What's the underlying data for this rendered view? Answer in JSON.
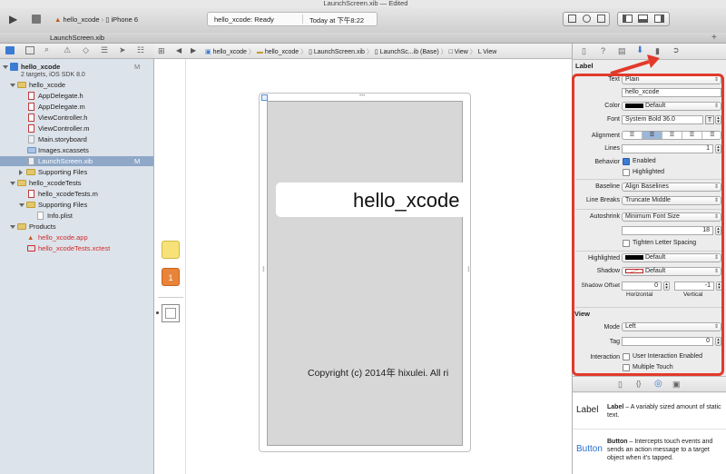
{
  "window": {
    "title": "LaunchScreen.xib — Edited"
  },
  "toolbar": {
    "scheme": "hello_xcode",
    "device": "iPhone 6",
    "status": "hello_xcode: Ready",
    "status_time": "Today at 下午8:22"
  },
  "tab": {
    "label": "LaunchScreen.xib"
  },
  "jumpbar": {
    "items": [
      "hello_xcode",
      "hello_xcode",
      "LaunchScreen.xib",
      "LaunchSc...ib (Base)",
      "View",
      "View"
    ]
  },
  "navigator": {
    "project": {
      "name": "hello_xcode",
      "subtitle": "2 targets, iOS SDK 8.0",
      "badge": "M"
    },
    "items": [
      {
        "label": "hello_xcode",
        "kind": "folder"
      },
      {
        "label": "AppDelegate.h",
        "kind": "h"
      },
      {
        "label": "AppDelegate.m",
        "kind": "m"
      },
      {
        "label": "ViewController.h",
        "kind": "h"
      },
      {
        "label": "ViewController.m",
        "kind": "m"
      },
      {
        "label": "Main.storyboard",
        "kind": "storyboard"
      },
      {
        "label": "Images.xcassets",
        "kind": "assets"
      },
      {
        "label": "LaunchScreen.xib",
        "kind": "xib",
        "badge": "M"
      },
      {
        "label": "Supporting Files",
        "kind": "folder"
      },
      {
        "label": "hello_xcodeTests",
        "kind": "folder"
      },
      {
        "label": "hello_xcodeTests.m",
        "kind": "m"
      },
      {
        "label": "Supporting Files",
        "kind": "folder"
      },
      {
        "label": "Info.plist",
        "kind": "plist"
      },
      {
        "label": "Products",
        "kind": "folder"
      },
      {
        "label": "hello_xcode.app",
        "kind": "app"
      },
      {
        "label": "hello_xcodeTests.xctest",
        "kind": "xctest"
      }
    ]
  },
  "canvas": {
    "label_text": "hello_xcode",
    "copyright": "Copyright (c) 2014年 hixulei. All ri"
  },
  "inspector": {
    "section": "Label",
    "text_label": "Text",
    "text_value": "Plain",
    "text_field": "hello_xcode",
    "color_label": "Color",
    "color_value": "Default",
    "font_label": "Font",
    "font_value": "System Bold 36.0",
    "alignment_label": "Alignment",
    "lines_label": "Lines",
    "lines_value": "1",
    "behavior_label": "Behavior",
    "enabled": "Enabled",
    "highlighted": "Highlighted",
    "baseline_label": "Baseline",
    "baseline_value": "Align Baselines",
    "linebreaks_label": "Line Breaks",
    "linebreaks_value": "Truncate Middle",
    "autoshrink_label": "Autoshrink",
    "autoshrink_value": "Minimum Font Size",
    "min_font_size": "18",
    "tighten": "Tighten Letter Spacing",
    "hl_label": "Highlighted",
    "hl_value": "Default",
    "shadow_label": "Shadow",
    "shadow_value": "Default",
    "shadow_offset_label": "Shadow Offset",
    "offset_h": "0",
    "offset_v": "-1",
    "horizontal": "Horizontal",
    "vertical": "Vertical",
    "view_section": "View",
    "mode_label": "Mode",
    "mode_value": "Left",
    "tag_label": "Tag",
    "tag_value": "0",
    "interaction_label": "Interaction",
    "user_interaction": "User Interaction Enabled",
    "multiple_touch": "Multiple Touch"
  },
  "library": [
    {
      "icon_text": "Label",
      "title": "Label",
      "desc": " – A variably sized amount of static text."
    },
    {
      "icon_text": "Button",
      "title": "Button",
      "desc": " – Intercepts touch events and sends an action message to a target object when it's tapped."
    }
  ],
  "colors": {
    "highlight_red": "#e23a2b",
    "selection": "#8fa8c8",
    "accent_blue": "#3b7bd4"
  }
}
